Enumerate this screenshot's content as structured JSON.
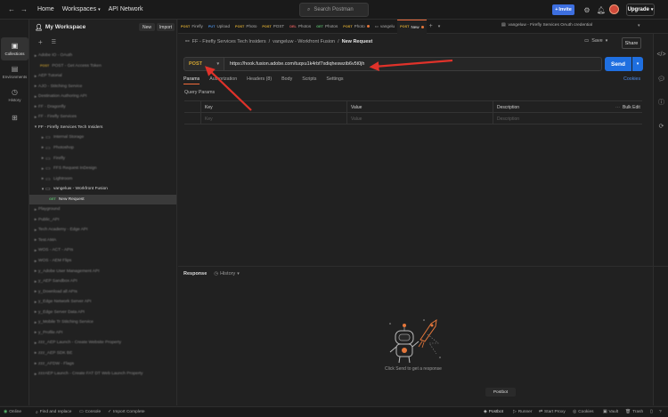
{
  "topbar": {
    "home": "Home",
    "workspaces": "Workspaces",
    "api_network": "API Network",
    "search_placeholder": "Search Postman",
    "invite": "Invite",
    "upgrade": "Upgrade"
  },
  "rail": {
    "items": [
      {
        "label": "Collections",
        "icon": "collections-icon"
      },
      {
        "label": "Environments",
        "icon": "environments-icon"
      },
      {
        "label": "History",
        "icon": "history-icon"
      },
      {
        "label": "",
        "icon": "flows-icon"
      }
    ]
  },
  "sidebar": {
    "workspace": "My Workspace",
    "new_label": "New",
    "import_label": "Import",
    "tree": [
      {
        "label": "Adobe IO - OAuth",
        "level": 1,
        "blur": true
      },
      {
        "label": "POST - Get Access Token",
        "level": 2,
        "blur": true,
        "method": "POST"
      },
      {
        "label": "AEP Tutorial",
        "level": 1,
        "blur": true
      },
      {
        "label": "AJO - Stitching Service",
        "level": 1,
        "blur": true
      },
      {
        "label": "Destination Authoring API",
        "level": 1,
        "blur": true
      },
      {
        "label": "FF - Dragonfly",
        "level": 1,
        "blur": true
      },
      {
        "label": "FF - Firefly Services",
        "level": 1,
        "blur": true
      },
      {
        "label": "FF - Firefly Services Tech Insiders",
        "level": 1,
        "blur": false,
        "open": true
      },
      {
        "label": "Internal Storage",
        "level": 2,
        "blur": true
      },
      {
        "label": "Photoshop",
        "level": 2,
        "blur": true
      },
      {
        "label": "Firefly",
        "level": 2,
        "blur": true
      },
      {
        "label": "FFS Request InDesign",
        "level": 2,
        "blur": true
      },
      {
        "label": "Lightroom",
        "level": 2,
        "blur": true
      },
      {
        "label": "vangeluw - Workfront Fusion",
        "level": 2,
        "blur": false,
        "open": true
      },
      {
        "label": "New Request",
        "level": 3,
        "blur": false,
        "method": "GET",
        "selected": true
      },
      {
        "label": "Playground",
        "level": 1,
        "blur": true
      },
      {
        "label": "Public_API",
        "level": 1,
        "blur": true
      },
      {
        "label": "Tech Academy - Edge API",
        "level": 1,
        "blur": true
      },
      {
        "label": "Test AMA",
        "level": 1,
        "blur": true
      },
      {
        "label": "WOS - ACT - APIs",
        "level": 1,
        "blur": true
      },
      {
        "label": "WOS - AEM Flips",
        "level": 1,
        "blur": true
      },
      {
        "label": "y_Adobe User Management API",
        "level": 1,
        "blur": true
      },
      {
        "label": "y_AEP Sandbox API",
        "level": 1,
        "blur": true
      },
      {
        "label": "y_Download all APIs",
        "level": 1,
        "blur": true
      },
      {
        "label": "y_Edge Network Server API",
        "level": 1,
        "blur": true
      },
      {
        "label": "y_Edge Server Data API",
        "level": 1,
        "blur": true
      },
      {
        "label": "y_Mobile Tr Stitching Service",
        "level": 1,
        "blur": true
      },
      {
        "label": "y_Profile API",
        "level": 1,
        "blur": true
      },
      {
        "label": "zzz_AEP Launch - Create Website Property",
        "level": 1,
        "blur": true
      },
      {
        "label": "zzz_AEP SDK BE",
        "level": 1,
        "blur": true
      },
      {
        "label": "zzz_AFDW - Flags",
        "level": 1,
        "blur": true
      },
      {
        "label": "zzzAEP Launch - Create FAT DT Web Launch Property",
        "level": 1,
        "blur": true
      }
    ]
  },
  "tabs": [
    {
      "method": "POST",
      "label": "Firefly"
    },
    {
      "method": "PUT",
      "label": "Upload"
    },
    {
      "method": "POST",
      "label": "Photo"
    },
    {
      "method": "POST",
      "label": "POST"
    },
    {
      "method": "DEL",
      "label": "Photos"
    },
    {
      "method": "GET",
      "label": "Photos"
    },
    {
      "method": "POST",
      "label": "Photo",
      "dot": true
    },
    {
      "method": "",
      "label": "vangelu"
    },
    {
      "method": "POST",
      "label": "New",
      "dot": true,
      "active": true
    }
  ],
  "env_selector": "vangeluw - Firefly Services OAuth credential",
  "breadcrumb": {
    "collection": "FF - Firefly Services Tech Insiders",
    "folder": "vangeluw - Workfront Fusion",
    "current": "New Request"
  },
  "actions": {
    "save": "Save",
    "share": "Share"
  },
  "request": {
    "method": "POST",
    "url": "https://hook.fusion.adobe.com/tuqxu1k4rbf7xdiqheswzib6v5t0jh",
    "send": "Send",
    "tabs": [
      "Params",
      "Authorization",
      "Headers (8)",
      "Body",
      "Scripts",
      "Settings"
    ],
    "cookies": "Cookies",
    "query_params_title": "Query Params",
    "table_headers": {
      "key": "Key",
      "value": "Value",
      "description": "Description",
      "bulk_edit": "Bulk Edit"
    },
    "placeholders": {
      "key": "Key",
      "value": "Value",
      "description": "Description"
    }
  },
  "response": {
    "title": "Response",
    "history": "History",
    "hint": "Click Send to get a response"
  },
  "postbot": "Postbot",
  "statusbar": {
    "online": "Online",
    "find_replace": "Find and replace",
    "console": "Console",
    "import_complete": "Import Complete",
    "postbot": "Postbot",
    "runner": "Runner",
    "start_proxy": "Start Proxy",
    "cookies": "Cookies",
    "vault": "Vault",
    "trash": "Trash"
  },
  "colors": {
    "accent": "#f26b3a",
    "send": "#1f6fe0",
    "post": "#d3a531",
    "get": "#58b56b",
    "arrow": "#e0322a"
  }
}
